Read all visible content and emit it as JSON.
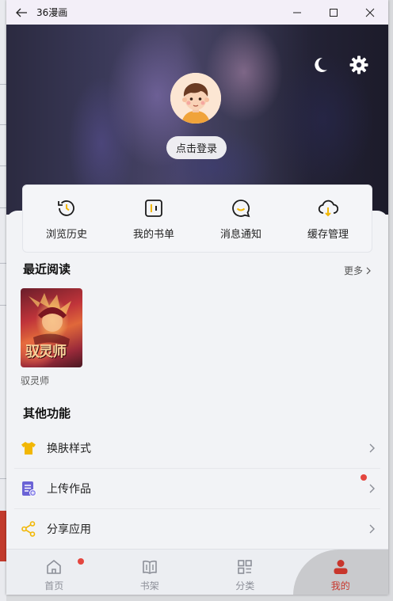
{
  "window": {
    "title": "36漫画"
  },
  "header": {
    "login_label": "点击登录"
  },
  "quick_actions": [
    {
      "label": "浏览历史",
      "icon": "history-icon"
    },
    {
      "label": "我的书单",
      "icon": "booklist-icon"
    },
    {
      "label": "消息通知",
      "icon": "message-icon"
    },
    {
      "label": "缓存管理",
      "icon": "cloud-download-icon"
    }
  ],
  "recent": {
    "title": "最近阅读",
    "more_label": "更多",
    "items": [
      {
        "name": "驭灵师",
        "cover_text": "驭灵师"
      }
    ]
  },
  "other": {
    "title": "其他功能",
    "items": [
      {
        "label": "换肤样式",
        "icon": "tshirt-icon"
      },
      {
        "label": "上传作品",
        "icon": "upload-doc-icon"
      },
      {
        "label": "分享应用",
        "icon": "share-icon"
      }
    ]
  },
  "tabs": [
    {
      "label": "首页",
      "icon": "home-icon"
    },
    {
      "label": "书架",
      "icon": "bookshelf-icon"
    },
    {
      "label": "分类",
      "icon": "category-icon"
    },
    {
      "label": "我的",
      "icon": "profile-icon",
      "active": true
    }
  ],
  "colors": {
    "accent": "#c8362c",
    "badge": "#e4463f",
    "icon_yellow": "#f2b705",
    "icon_purple": "#6b63d6"
  }
}
